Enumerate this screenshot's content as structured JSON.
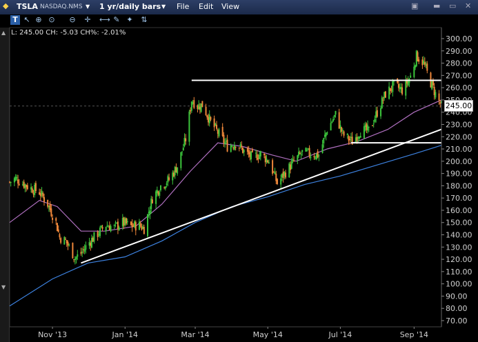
{
  "window": {
    "symbol": "TSLA",
    "exchange": "NASDAQ.NMS",
    "period": "1 yr/daily bars",
    "menu": [
      "File",
      "Edit",
      "View"
    ]
  },
  "quote_line": "L: 245.00 CH: -5.03 CH%: -2.01%",
  "last_price_label": "245.00",
  "colors": {
    "up": "#3cc63c",
    "down": "#f0883a",
    "ma_short": "#b070c0",
    "ma_long": "#3d82e0",
    "trendline": "#ffffff"
  },
  "chart_data": {
    "type": "candlestick",
    "y_ticks": [
      70,
      80,
      90,
      100,
      110,
      120,
      130,
      140,
      150,
      160,
      170,
      180,
      190,
      200,
      210,
      220,
      230,
      240,
      250,
      260,
      270,
      280,
      290,
      300
    ],
    "y_tick_labels": [
      "70.00",
      "80.00",
      "90.00",
      "100.00",
      "110.00",
      "120.00",
      "130.00",
      "140.00",
      "150.00",
      "160.00",
      "170.00",
      "180.00",
      "190.00",
      "200.00",
      "210.00",
      "220.00",
      "230.00",
      "240.00",
      "250.00",
      "260.00",
      "270.00",
      "280.00",
      "290.00",
      "300.00"
    ],
    "ylim": [
      70,
      300
    ],
    "x_labels": [
      "Nov '13",
      "Jan '14",
      "Mar '14",
      "May '14",
      "Jul '14",
      "Sep '14"
    ],
    "x_label_dates": [
      "2013-11-01",
      "2014-01-01",
      "2014-03-01",
      "2014-05-01",
      "2014-07-01",
      "2014-09-01"
    ],
    "xlim": [
      "2013-09-26",
      "2014-09-24"
    ],
    "last_price": 245.0,
    "close_path": [
      [
        "2013-09-26",
        183
      ],
      [
        "2013-10-01",
        186
      ],
      [
        "2013-10-07",
        182
      ],
      [
        "2013-10-14",
        178
      ],
      [
        "2013-10-21",
        175
      ],
      [
        "2013-10-28",
        165
      ],
      [
        "2013-11-04",
        150
      ],
      [
        "2013-11-07",
        138
      ],
      [
        "2013-11-12",
        135
      ],
      [
        "2013-11-15",
        130
      ],
      [
        "2013-11-20",
        121
      ],
      [
        "2013-11-25",
        125
      ],
      [
        "2013-12-02",
        134
      ],
      [
        "2013-12-09",
        141
      ],
      [
        "2013-12-16",
        148
      ],
      [
        "2013-12-23",
        146
      ],
      [
        "2013-12-30",
        150
      ],
      [
        "2014-01-06",
        147
      ],
      [
        "2014-01-13",
        148
      ],
      [
        "2014-01-17",
        145
      ],
      [
        "2014-01-24",
        170
      ],
      [
        "2014-01-31",
        180
      ],
      [
        "2014-02-07",
        185
      ],
      [
        "2014-02-14",
        196
      ],
      [
        "2014-02-21",
        218
      ],
      [
        "2014-02-26",
        250
      ],
      [
        "2014-03-03",
        245
      ],
      [
        "2014-03-07",
        246
      ],
      [
        "2014-03-14",
        232
      ],
      [
        "2014-03-21",
        222
      ],
      [
        "2014-03-28",
        212
      ],
      [
        "2014-04-04",
        215
      ],
      [
        "2014-04-11",
        208
      ],
      [
        "2014-04-18",
        203
      ],
      [
        "2014-04-25",
        206
      ],
      [
        "2014-05-02",
        200
      ],
      [
        "2014-05-09",
        182
      ],
      [
        "2014-05-16",
        191
      ],
      [
        "2014-05-23",
        200
      ],
      [
        "2014-05-30",
        207
      ],
      [
        "2014-06-06",
        206
      ],
      [
        "2014-06-13",
        205
      ],
      [
        "2014-06-20",
        226
      ],
      [
        "2014-06-27",
        238
      ],
      [
        "2014-07-03",
        222
      ],
      [
        "2014-07-11",
        216
      ],
      [
        "2014-07-18",
        225
      ],
      [
        "2014-07-25",
        225
      ],
      [
        "2014-08-01",
        240
      ],
      [
        "2014-08-08",
        255
      ],
      [
        "2014-08-15",
        262
      ],
      [
        "2014-08-22",
        258
      ],
      [
        "2014-08-29",
        269
      ],
      [
        "2014-09-03",
        286
      ],
      [
        "2014-09-09",
        280
      ],
      [
        "2014-09-15",
        264
      ],
      [
        "2014-09-19",
        255
      ],
      [
        "2014-09-24",
        245
      ]
    ],
    "moving_average_short": [
      [
        "2013-09-26",
        150
      ],
      [
        "2013-10-21",
        168
      ],
      [
        "2013-11-05",
        163
      ],
      [
        "2013-11-25",
        143
      ],
      [
        "2013-12-15",
        143
      ],
      [
        "2014-01-10",
        147
      ],
      [
        "2014-02-01",
        165
      ],
      [
        "2014-02-25",
        192
      ],
      [
        "2014-03-20",
        215
      ],
      [
        "2014-04-10",
        212
      ],
      [
        "2014-05-05",
        205
      ],
      [
        "2014-05-25",
        200
      ],
      [
        "2014-06-20",
        210
      ],
      [
        "2014-07-15",
        216
      ],
      [
        "2014-08-10",
        226
      ],
      [
        "2014-09-01",
        240
      ],
      [
        "2014-09-24",
        250
      ]
    ],
    "moving_average_long": [
      [
        "2013-09-26",
        82
      ],
      [
        "2013-11-01",
        104
      ],
      [
        "2013-12-01",
        117
      ],
      [
        "2014-01-01",
        122
      ],
      [
        "2014-02-01",
        135
      ],
      [
        "2014-03-01",
        150
      ],
      [
        "2014-04-01",
        163
      ],
      [
        "2014-05-01",
        171
      ],
      [
        "2014-06-01",
        181
      ],
      [
        "2014-07-01",
        188
      ],
      [
        "2014-08-01",
        197
      ],
      [
        "2014-09-01",
        206
      ],
      [
        "2014-09-24",
        213
      ]
    ],
    "trendlines": [
      {
        "kind": "support",
        "from": [
          "2013-11-25",
          117
        ],
        "to": [
          "2014-09-24",
          226
        ]
      }
    ],
    "horizontal_lines": [
      {
        "price": 266,
        "from": "2014-02-26",
        "to": "2014-09-24"
      },
      {
        "price": 215,
        "from": "2014-07-10",
        "to": "2014-09-24"
      }
    ]
  }
}
